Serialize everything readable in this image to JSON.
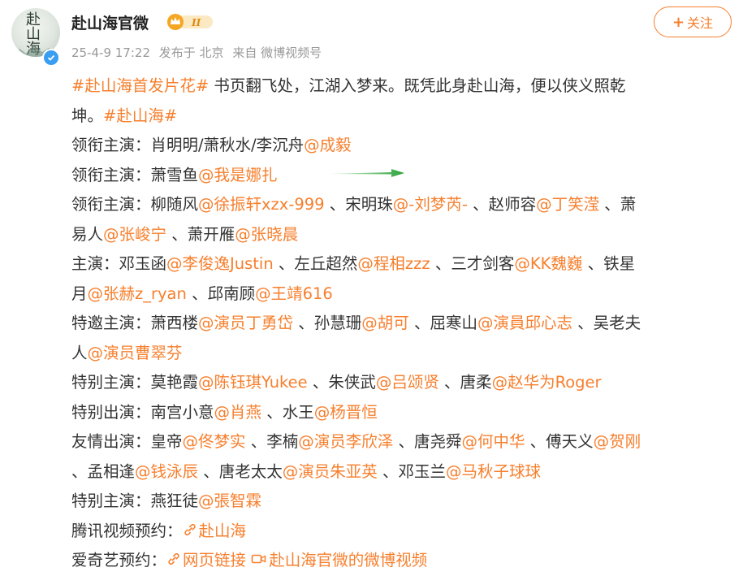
{
  "header": {
    "name": "赴山海官微",
    "badge_level": "II",
    "timestamp": "25-4-9 17:22",
    "published_from": "发布于 北京",
    "source": "来自 微博视频号",
    "follow_label": "关注"
  },
  "post": {
    "line1": {
      "hashtag1": "#赴山海首发片花#",
      "text": " 书页翻飞处，江湖入梦来。既凭此身赴山海，便以侠义照乾"
    },
    "line2": {
      "text": "坤。",
      "hashtag2": "#赴山海#"
    },
    "line3": {
      "label": "领衔主演：肖明明/萧秋水/李沉舟",
      "mention": "@成毅"
    },
    "line4": {
      "label": "领衔主演：萧雪鱼",
      "mention": "@我是娜扎"
    },
    "line5": {
      "t1": "领衔主演：柳随风",
      "m1": "@徐振轩xzx-999",
      "t2": " 、宋明珠",
      "m2": "@-刘梦芮-",
      "t3": " 、赵师容",
      "m3": "@丁笑滢",
      "t4": " 、萧"
    },
    "line6": {
      "t1": "易人",
      "m1": "@张峻宁",
      "t2": " 、萧开雁",
      "m2": "@张晓晨"
    },
    "line7": {
      "t1": "主演：邓玉函",
      "m1": "@李俊逸Justin",
      "t2": " 、左丘超然",
      "m2": "@程相zzz",
      "t3": " 、三才剑客",
      "m3": "@KK魏巍",
      "t4": " 、铁星"
    },
    "line8": {
      "t1": "月",
      "m1": "@张赫z_ryan",
      "t2": " 、邱南顾",
      "m2": "@王靖616"
    },
    "line9": {
      "t1": "特邀主演：萧西楼",
      "m1": "@演员丁勇岱",
      "t2": " 、孙慧珊",
      "m2": "@胡可",
      "t3": " 、屈寒山",
      "m3": "@演員邱心志",
      "t4": " 、吴老夫"
    },
    "line10": {
      "t1": "人",
      "m1": "@演员曹翠芬"
    },
    "line11": {
      "t1": "特别主演：莫艳霞",
      "m1": "@陈钰琪Yukee",
      "t2": " 、朱侠武",
      "m2": "@吕颂贤",
      "t3": " 、唐柔",
      "m3": "@赵华为Roger"
    },
    "line12": {
      "t1": "特别出演：南宫小意",
      "m1": "@肖燕",
      "t2": " 、水王",
      "m2": "@杨晋恒"
    },
    "line13": {
      "t1": "友情出演：皇帝",
      "m1": "@佟梦实",
      "t2": " 、李楠",
      "m2": "@演员李欣泽",
      "t3": " 、唐尧舜",
      "m3": "@何中华",
      "t4": " 、傅天义",
      "m4": "@贺刚"
    },
    "line14": {
      "t1": "、孟相逢",
      "m1": "@钱泳辰",
      "t2": " 、唐老太太",
      "m2": "@演员朱亚英",
      "t3": " 、邓玉兰",
      "m3": "@马秋子球球"
    },
    "line15": {
      "t1": "特别主演：燕狂徒",
      "m1": "@張智霖"
    },
    "line16": {
      "t1": "腾讯视频预约：",
      "link": "赴山海"
    },
    "line17": {
      "t1": "爱奇艺预约：",
      "link1": "网页链接",
      "link2": "赴山海官微的微博视频"
    }
  },
  "colors": {
    "accent": "#f77f2d",
    "text": "#333333",
    "meta": "#999999",
    "arrow": "#2aa33a",
    "verified": "#3a9ef0"
  },
  "icons": [
    "verified-icon",
    "crown-badge-icon",
    "link-chain-icon",
    "video-camera-icon",
    "green-arrow-annotation"
  ]
}
